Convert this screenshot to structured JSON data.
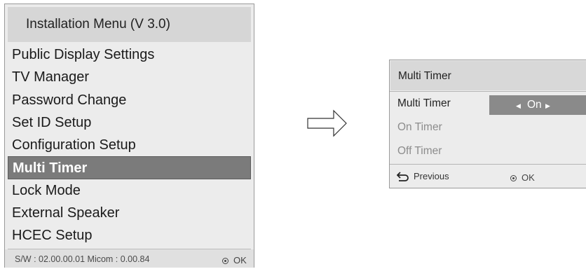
{
  "installation_menu": {
    "title": "Installation Menu (V 3.0)",
    "items": [
      "Public Display Settings",
      "TV Manager",
      "Password Change",
      "Set ID Setup",
      "Configuration Setup",
      "Multi Timer",
      "Lock Mode",
      "External Speaker",
      "HCEC Setup"
    ],
    "selected_item": "Multi Timer",
    "footer": {
      "version": "S/W : 02.00.00.01 Micom : 0.00.84",
      "ok_label": "OK"
    }
  },
  "arrow_icon": "right-arrow-outline-icon",
  "multi_timer_dialog": {
    "title": "Multi Timer",
    "rows": {
      "multi_timer_label": "Multi Timer",
      "multi_timer_value": "On",
      "on_timer_label": "On Timer",
      "off_timer_label": "Off Timer"
    },
    "footer": {
      "previous_label": "Previous",
      "ok_label": "OK"
    }
  },
  "colors": {
    "panel_bg": "#ececec",
    "header_bg": "#d6d6d6",
    "selected_bg": "#7b7b7b",
    "value_bg": "#8a8a8a",
    "disabled_text": "#8c8c8c"
  }
}
